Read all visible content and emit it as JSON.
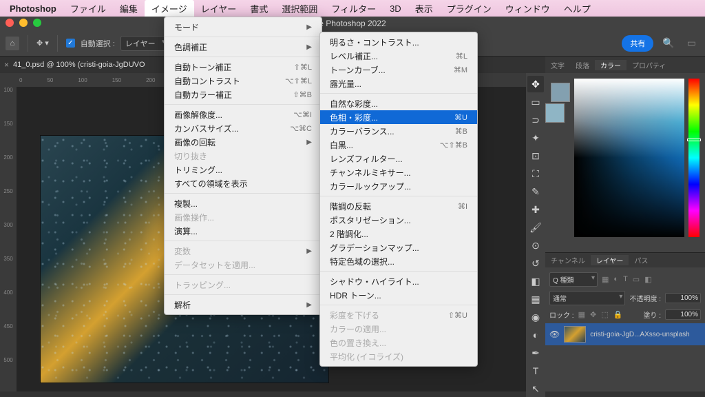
{
  "menubar": {
    "app": "Photoshop",
    "items": [
      "ファイル",
      "編集",
      "イメージ",
      "レイヤー",
      "書式",
      "選択範囲",
      "フィルター",
      "3D",
      "表示",
      "プラグイン",
      "ウィンドウ",
      "ヘルプ"
    ],
    "active_index": 2
  },
  "window_title": "e Photoshop 2022",
  "optbar": {
    "autoselect_label": "自動選択 :",
    "autoselect_value": "レイヤー",
    "share": "共有"
  },
  "tab": {
    "label": "41_0.psd @ 100% (cristi-goia-JgDUVO"
  },
  "ruler_h": [
    "0",
    "50",
    "100",
    "150",
    "200"
  ],
  "ruler_v": [
    "100",
    "150",
    "200",
    "250",
    "300",
    "350",
    "400",
    "450",
    "500"
  ],
  "image_menu": [
    {
      "label": "モード",
      "arrow": true
    },
    {
      "div": true
    },
    {
      "label": "色調補正",
      "arrow": true,
      "open": true
    },
    {
      "div": true
    },
    {
      "label": "自動トーン補正",
      "key": "⇧⌘L"
    },
    {
      "label": "自動コントラスト",
      "key": "⌥⇧⌘L"
    },
    {
      "label": "自動カラー補正",
      "key": "⇧⌘B"
    },
    {
      "div": true
    },
    {
      "label": "画像解像度...",
      "key": "⌥⌘I"
    },
    {
      "label": "カンバスサイズ...",
      "key": "⌥⌘C"
    },
    {
      "label": "画像の回転",
      "arrow": true
    },
    {
      "label": "切り抜き",
      "disabled": true
    },
    {
      "label": "トリミング..."
    },
    {
      "label": "すべての領域を表示"
    },
    {
      "div": true
    },
    {
      "label": "複製..."
    },
    {
      "label": "画像操作...",
      "disabled": true
    },
    {
      "label": "演算..."
    },
    {
      "div": true
    },
    {
      "label": "変数",
      "arrow": true,
      "disabled": true
    },
    {
      "label": "データセットを適用...",
      "disabled": true
    },
    {
      "div": true
    },
    {
      "label": "トラッピング...",
      "disabled": true
    },
    {
      "div": true
    },
    {
      "label": "解析",
      "arrow": true
    }
  ],
  "adjust_menu": [
    {
      "label": "明るさ・コントラスト..."
    },
    {
      "label": "レベル補正...",
      "key": "⌘L"
    },
    {
      "label": "トーンカーブ...",
      "key": "⌘M"
    },
    {
      "label": "露光量..."
    },
    {
      "div": true
    },
    {
      "label": "自然な彩度..."
    },
    {
      "label": "色相・彩度...",
      "key": "⌘U",
      "hi": true
    },
    {
      "label": "カラーバランス...",
      "key": "⌘B"
    },
    {
      "label": "白黒...",
      "key": "⌥⇧⌘B"
    },
    {
      "label": "レンズフィルター..."
    },
    {
      "label": "チャンネルミキサー..."
    },
    {
      "label": "カラールックアップ..."
    },
    {
      "div": true
    },
    {
      "label": "階調の反転",
      "key": "⌘I"
    },
    {
      "label": "ポスタリゼーション..."
    },
    {
      "label": "2 階調化..."
    },
    {
      "label": "グラデーションマップ..."
    },
    {
      "label": "特定色域の選択..."
    },
    {
      "div": true
    },
    {
      "label": "シャドウ・ハイライト..."
    },
    {
      "label": "HDR トーン..."
    },
    {
      "div": true
    },
    {
      "label": "彩度を下げる",
      "key": "⇧⌘U",
      "disabled": true
    },
    {
      "label": "カラーの適用...",
      "disabled": true
    },
    {
      "label": "色の置き換え...",
      "disabled": true
    },
    {
      "label": "平均化 (イコライズ)",
      "disabled": true
    }
  ],
  "panels": {
    "top_tabs": [
      "文字",
      "段落",
      "カラー",
      "プロパティ"
    ],
    "top_active": 2,
    "mid_tabs": [
      "チャンネル",
      "レイヤー",
      "パス"
    ],
    "mid_active": 1,
    "layer_filter": "Q 種類",
    "blend_mode": "通常",
    "opacity_label": "不透明度 :",
    "opacity_value": "100%",
    "lock_label": "ロック :",
    "fill_label": "塗り :",
    "fill_value": "100%",
    "layer_name": "cristi-goia-JgD...AXsso-unsplash"
  }
}
